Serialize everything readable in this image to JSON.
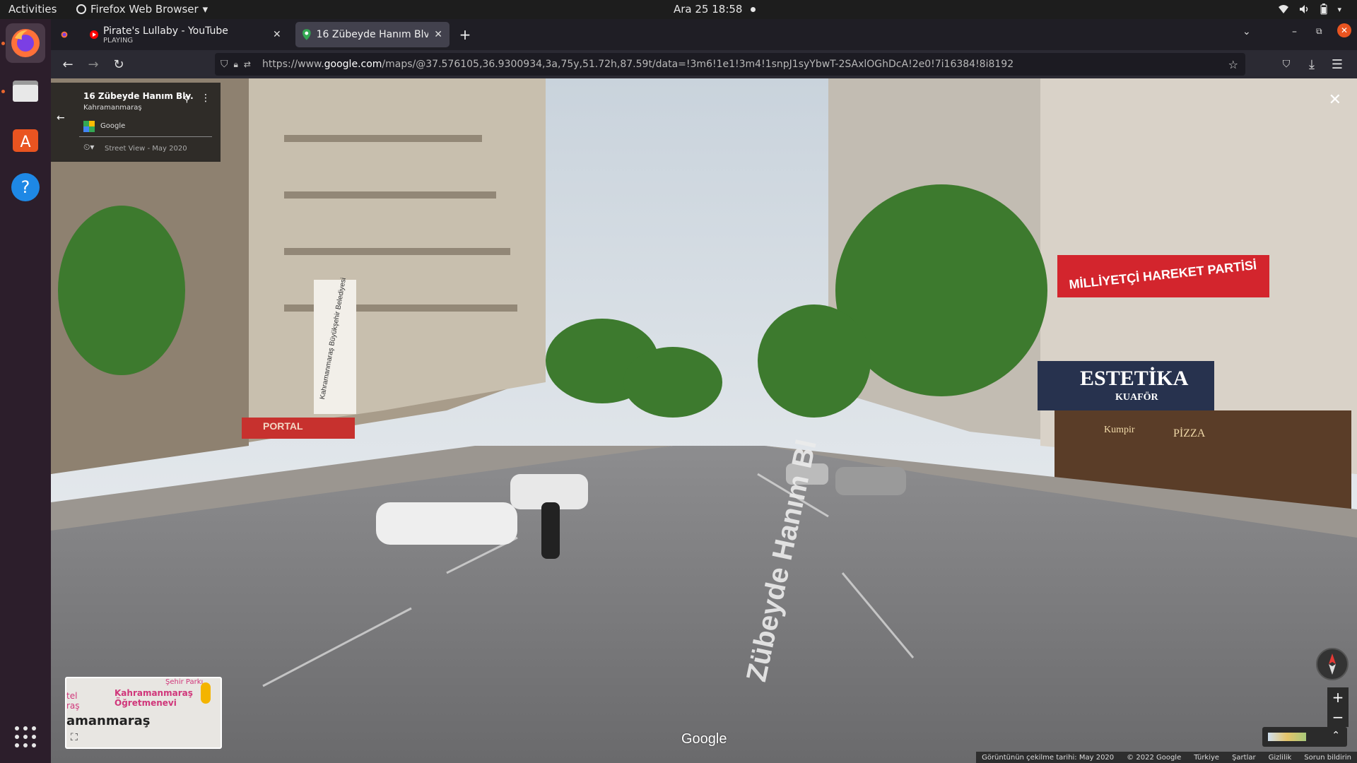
{
  "topbar": {
    "activities": "Activities",
    "app_name": "Firefox Web Browser",
    "clock": "Ara 25  18:58"
  },
  "dock": {
    "items": [
      {
        "name": "Firefox",
        "icon": "firefox-icon"
      },
      {
        "name": "Files",
        "icon": "files-icon"
      },
      {
        "name": "Ubuntu Software",
        "icon": "software-icon"
      },
      {
        "name": "Help",
        "icon": "help-icon"
      },
      {
        "name": "Show Applications",
        "icon": "grid-icon"
      }
    ]
  },
  "browser": {
    "tabs": [
      {
        "title": "Pirate's Lullaby - YouTube",
        "subtitle": "PLAYING",
        "active": false
      },
      {
        "title": "16 Zübeyde Hanım Blv. - G",
        "active": true
      }
    ],
    "new_tab": "+",
    "url": {
      "prefix": "https://www.",
      "domain": "google.com",
      "rest": "/maps/@37.576105,36.9300934,3a,75y,51.72h,87.59t/data=!3m6!1e1!3m4!1snpJ1syYbwT-2SAxlOGhDcA!2e0!7i16384!8i8192"
    }
  },
  "streetview": {
    "card": {
      "title": "16 Zübeyde Hanım Blv.",
      "city": "Kahramanmaraş",
      "provider": "Google",
      "capture": "Street View - May 2020"
    },
    "scene_text": {
      "party_sign": "MİLLİYETÇİ HAREKET PARTİSİ",
      "salon_sign": "ESTETİKA",
      "salon_sub": "KUAFÖR",
      "banner": "Kahramanmaraş Büyükşehir Belediyesi",
      "road": "Zübeyde Hanım Bl",
      "portal": "PORTAL",
      "cafe": "Kumpir",
      "pizza": "PİZZA"
    },
    "minimap": {
      "city": "amanmaraş",
      "poi": "Kahramanmaraş\nÖğretmenevi",
      "hotel": "tel\nraş",
      "park": "Şehir Parkı"
    },
    "watermark": "Google",
    "footer": [
      "Görüntünün çekilme tarihi: May 2020",
      "© 2022 Google",
      "Türkiye",
      "Şartlar",
      "Gizlilik",
      "Sorun bildirin"
    ]
  }
}
